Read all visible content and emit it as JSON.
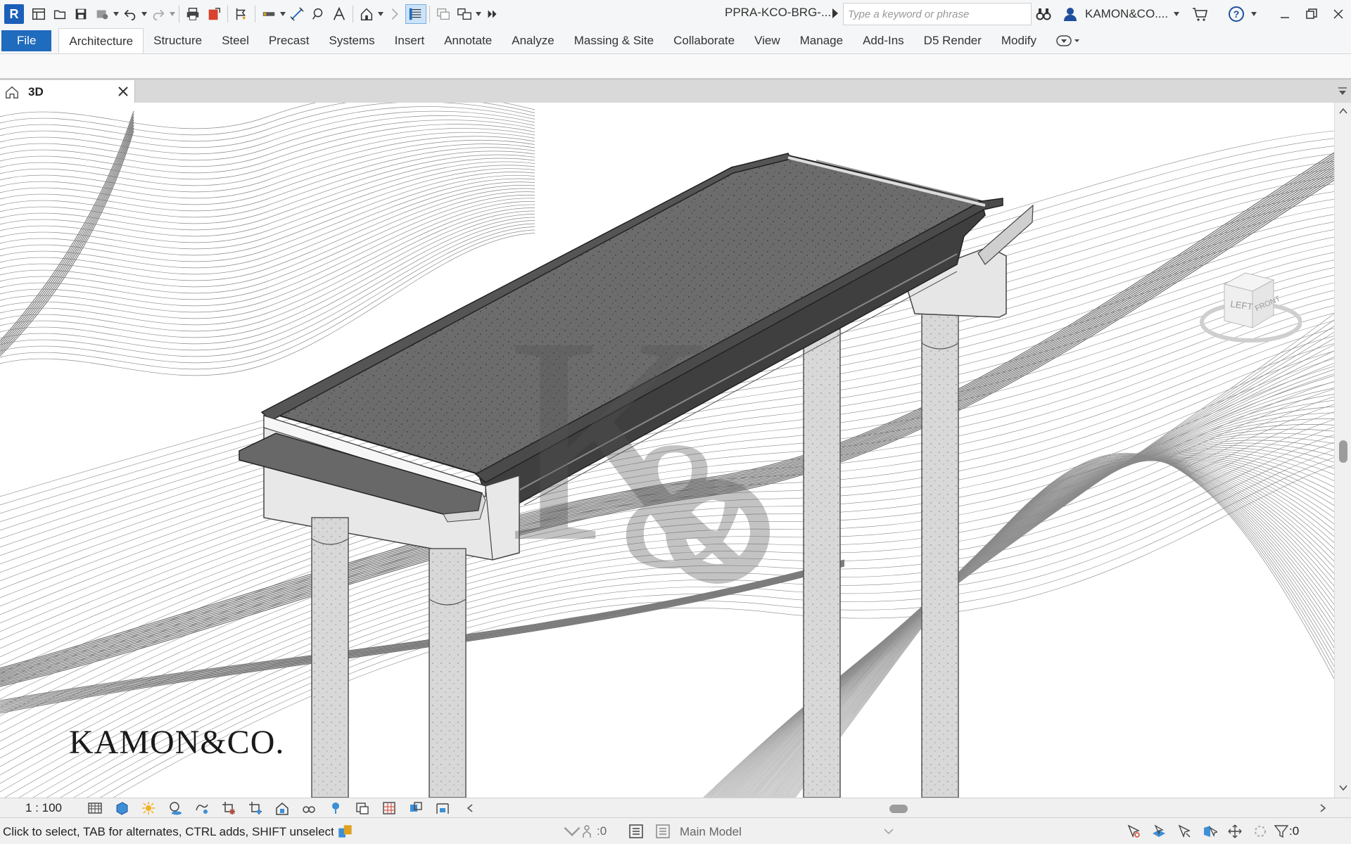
{
  "app": {
    "file_name": "PPRA-KCO-BRG-...",
    "search_placeholder": "Type a keyword or phrase",
    "user_name": "KAMON&CO....",
    "logo_letter": "R"
  },
  "ribbon": {
    "tabs": [
      {
        "label": "File",
        "kind": "file"
      },
      {
        "label": "Architecture",
        "kind": "active"
      },
      {
        "label": "Structure"
      },
      {
        "label": "Steel"
      },
      {
        "label": "Precast"
      },
      {
        "label": "Systems"
      },
      {
        "label": "Insert"
      },
      {
        "label": "Annotate"
      },
      {
        "label": "Analyze"
      },
      {
        "label": "Massing & Site"
      },
      {
        "label": "Collaborate"
      },
      {
        "label": "View"
      },
      {
        "label": "Manage"
      },
      {
        "label": "Add-Ins"
      },
      {
        "label": "D5 Render"
      },
      {
        "label": "Modify"
      }
    ]
  },
  "view": {
    "tab_label": "3D",
    "watermark_text": "KAMON&CO.",
    "viewcube_left": "LEFT",
    "viewcube_front": "FRONT"
  },
  "view_control": {
    "scale": "1 : 100"
  },
  "status": {
    "text": "Click to select, TAB for alternates, CTRL adds, SHIFT unselect",
    "workset_count": ":0",
    "model": "Main Model",
    "filter_count": ":0"
  },
  "colors": {
    "file_tab": "#1f6bbd",
    "deck": "#6a6a6a",
    "concrete": "#dcdcdc",
    "terrain_line": "#8a8a8a"
  }
}
